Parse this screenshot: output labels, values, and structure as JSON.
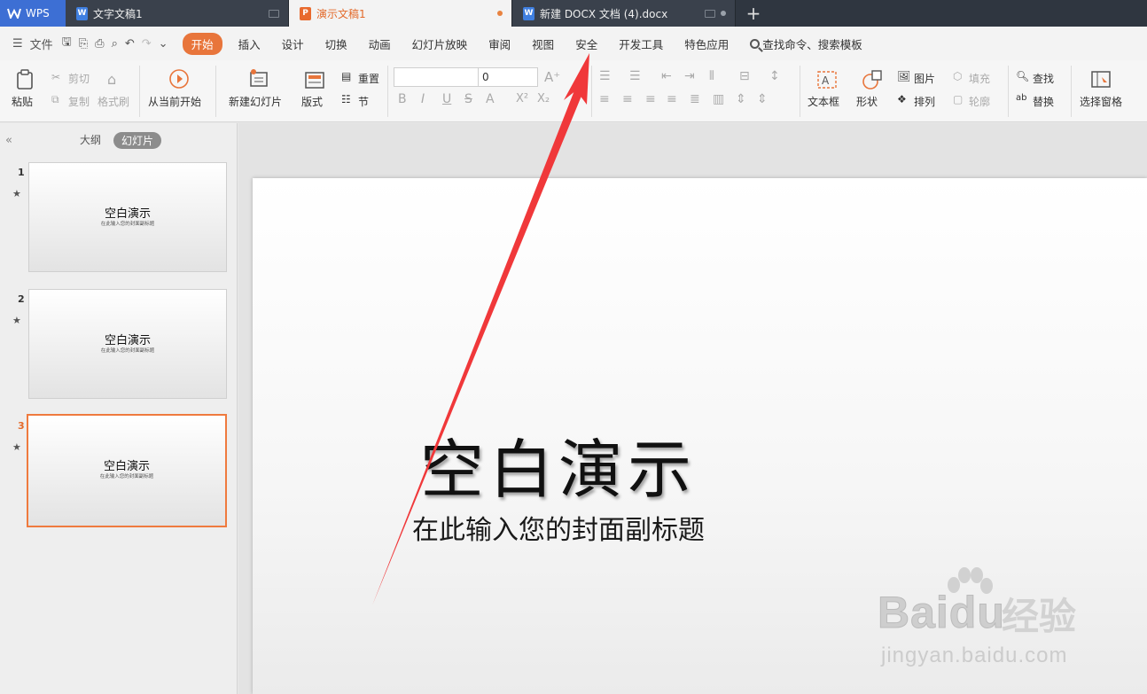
{
  "tabs": {
    "wps_label": "WPS",
    "items": [
      {
        "title": "文字文稿1",
        "kind": "writer"
      },
      {
        "title": "演示文稿1",
        "kind": "presentation"
      },
      {
        "title": "新建 DOCX 文档 (4).docx",
        "kind": "writer"
      }
    ]
  },
  "menu": {
    "file": "文件",
    "items": [
      "开始",
      "插入",
      "设计",
      "切换",
      "动画",
      "幻灯片放映",
      "审阅",
      "视图",
      "安全",
      "开发工具",
      "特色应用"
    ],
    "search": "查找命令、搜索模板"
  },
  "ribbon": {
    "paste": "粘贴",
    "cut": "剪切",
    "copy": "复制",
    "format_painter": "格式刷",
    "from_current": "从当前开始",
    "new_slide": "新建幻灯片",
    "layout": "版式",
    "reset": "重置",
    "section": "节",
    "font_size_value": "0",
    "text_box": "文本框",
    "shape": "形状",
    "picture": "图片",
    "fill": "填充",
    "arrange": "排列",
    "outline": "轮廓",
    "find": "查找",
    "replace": "替换",
    "selection_pane": "选择窗格"
  },
  "left_panel": {
    "tab_outline": "大纲",
    "tab_slides": "幻灯片",
    "slides": [
      {
        "num": "1",
        "title": "空白演示",
        "subtitle": "在此输入您的封面副标题"
      },
      {
        "num": "2",
        "title": "空白演示",
        "subtitle": "在此输入您的封面副标题"
      },
      {
        "num": "3",
        "title": "空白演示",
        "subtitle": "在此输入您的封面副标题"
      }
    ]
  },
  "slide": {
    "title": "空白演示",
    "subtitle": "在此输入您的封面副标题"
  },
  "watermark": {
    "brand": "Baidu",
    "brand_cn": "经验",
    "url": "jingyan.baidu.com"
  },
  "colors": {
    "accent": "#e8753b",
    "annotation_arrow": "#f0383a"
  }
}
